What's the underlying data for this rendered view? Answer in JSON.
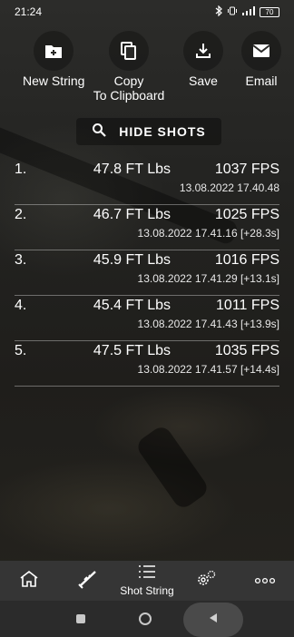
{
  "status_bar": {
    "time": "21:24",
    "icons": [
      "bluetooth-icon",
      "vibrate-icon",
      "signal-icon",
      "battery-icon"
    ],
    "battery": "70"
  },
  "toolbar": {
    "new_string": "New String",
    "copy_line1": "Copy",
    "copy_line2": "To Clipboard",
    "save": "Save",
    "email": "Email"
  },
  "hide_shots_label": "HIDE SHOTS",
  "shots": [
    {
      "index": "1.",
      "energy": "47.8 FT Lbs",
      "fps": "1037 FPS",
      "time": "13.08.2022 17.40.48"
    },
    {
      "index": "2.",
      "energy": "46.7 FT Lbs",
      "fps": "1025 FPS",
      "time": "13.08.2022 17.41.16 [+28.3s]"
    },
    {
      "index": "3.",
      "energy": "45.9 FT Lbs",
      "fps": "1016 FPS",
      "time": "13.08.2022 17.41.29 [+13.1s]"
    },
    {
      "index": "4.",
      "energy": "45.4 FT Lbs",
      "fps": "1011 FPS",
      "time": "13.08.2022 17.41.43 [+13.9s]"
    },
    {
      "index": "5.",
      "energy": "47.5 FT Lbs",
      "fps": "1035 FPS",
      "time": "13.08.2022 17.41.57 [+14.4s]"
    }
  ],
  "bottom_nav": {
    "items": [
      "home-icon",
      "rifle-icon",
      "list-icon",
      "settings-icon",
      "more-icon"
    ],
    "active_label": "Shot String"
  },
  "colors": {
    "nav_background": "#353535",
    "system_nav_background": "#2b2b2b",
    "text": "#ffffff"
  }
}
